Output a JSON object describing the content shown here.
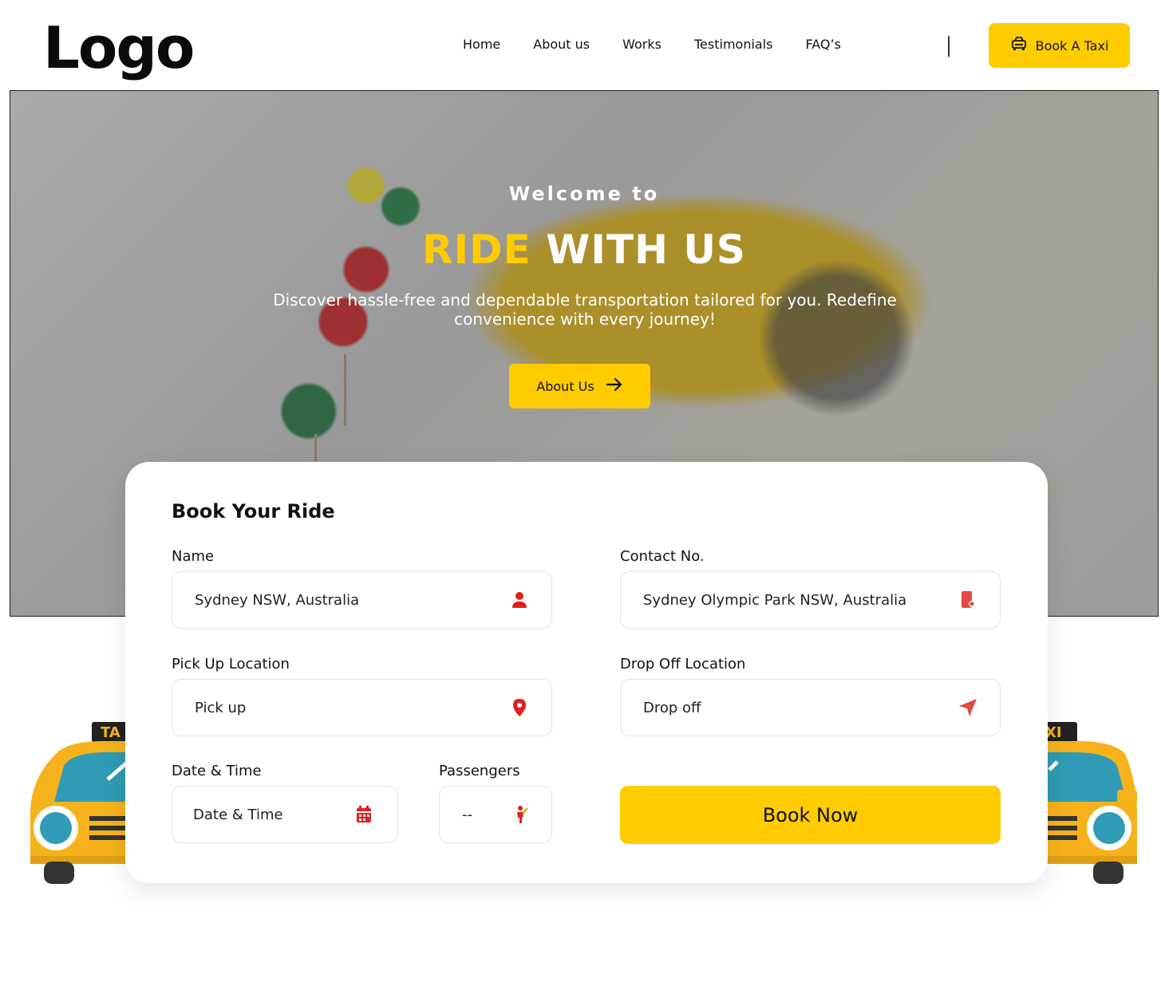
{
  "header": {
    "logo": "Logo",
    "nav": [
      "Home",
      "About us",
      "Works",
      "Testimonials",
      "FAQ’s"
    ],
    "cta_label": "Book A Taxi"
  },
  "hero": {
    "welcome": "Welcome to",
    "headline_accent": "RIDE",
    "headline_rest": "WITH US",
    "subtitle": "Discover hassle-free and dependable transportation tailored for you. Redefine convenience with every journey!",
    "button_label": "About Us"
  },
  "booking": {
    "title": "Book Your Ride",
    "name": {
      "label": "Name",
      "value": "Sydney NSW, Australia"
    },
    "contact": {
      "label": "Contact No.",
      "value": "Sydney Olympic Park NSW, Australia"
    },
    "pickup": {
      "label": "Pick Up Location",
      "value": "Pick up"
    },
    "dropoff": {
      "label": "Drop Off Location",
      "value": "Drop off"
    },
    "datetime": {
      "label": "Date & Time",
      "value": "Date & Time"
    },
    "passengers": {
      "label": "Passengers",
      "value": "--"
    },
    "submit_label": "Book Now"
  },
  "decor": {
    "taxi_left_text": "TA",
    "taxi_right_text": "XI"
  },
  "colors": {
    "accent": "#ffcc00",
    "icon_red": "#e0201c"
  }
}
